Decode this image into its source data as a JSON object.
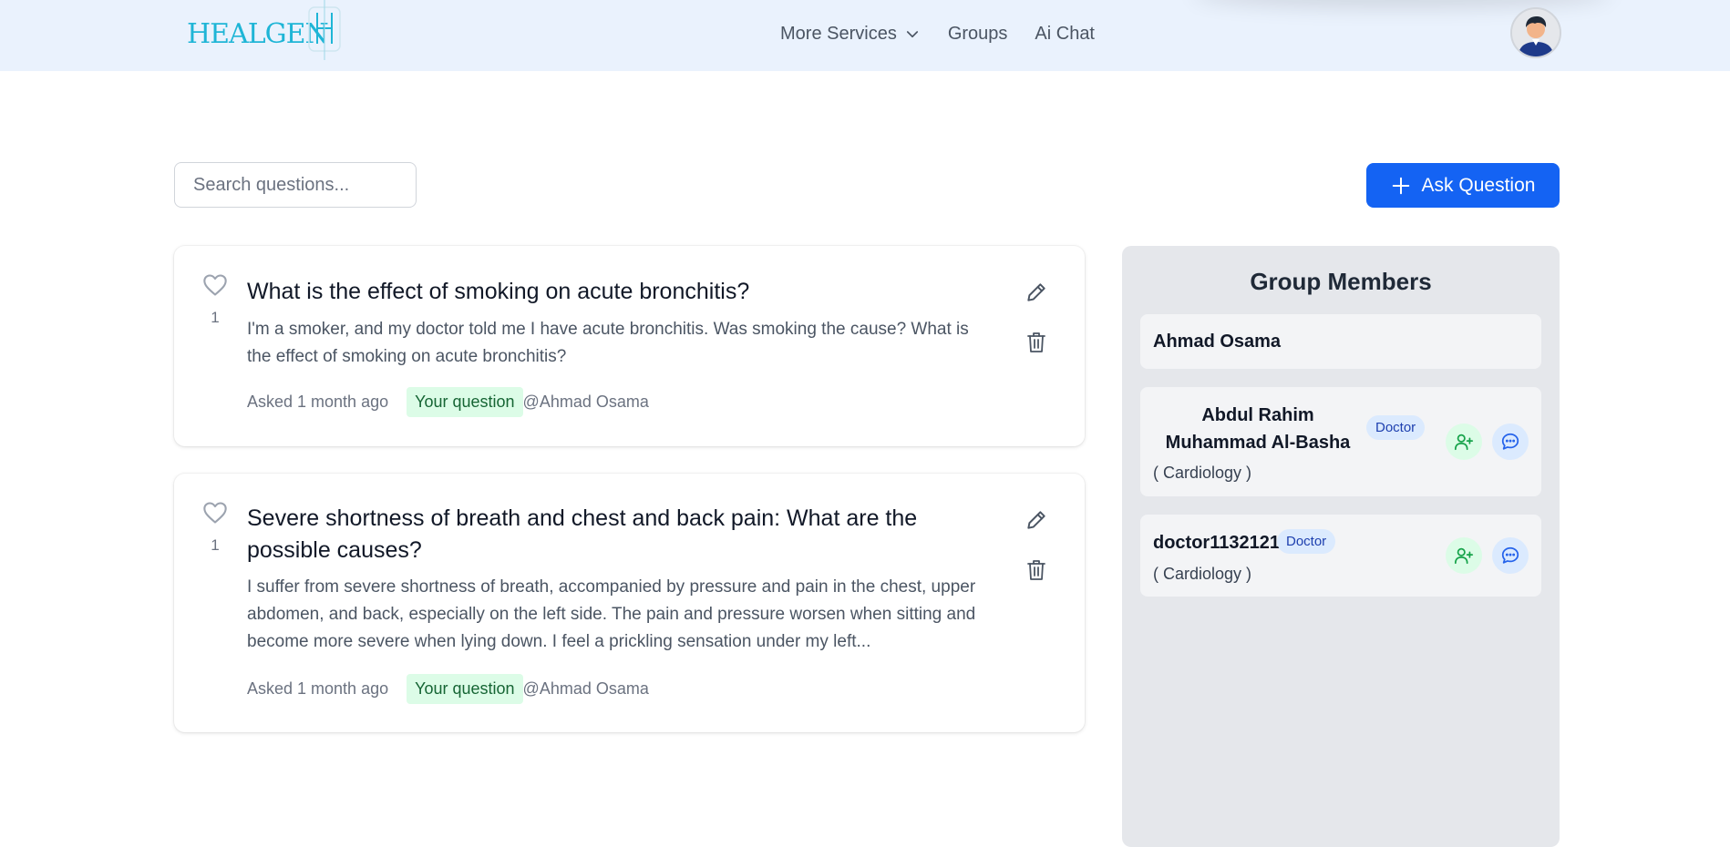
{
  "header": {
    "logo_text": "HEALGEN",
    "nav": {
      "more_services": "More Services",
      "groups": "Groups",
      "ai_chat": "Ai Chat"
    }
  },
  "toolbar": {
    "search_placeholder": "Search questions...",
    "ask_label": "Ask Question"
  },
  "questions": [
    {
      "likes": "1",
      "title": "What is the effect of smoking on acute bronchitis?",
      "body": "I'm a smoker, and my doctor told me I have acute bronchitis. Was smoking the cause? What is the effect of smoking on acute bronchitis?",
      "asked": "Asked 1 month ago",
      "badge": "Your question",
      "author": "@Ahmad Osama"
    },
    {
      "likes": "1",
      "title": "Severe shortness of breath and chest and back pain: What are the possible causes?",
      "body": "I suffer from severe shortness of breath, accompanied by pressure and pain in the chest, upper abdomen, and back, especially on the left side. The pain and pressure worsen when sitting and become more severe when lying down. I feel a prickling sensation under my left...",
      "asked": "Asked 1 month ago",
      "badge": "Your question",
      "author": "@Ahmad Osama"
    }
  ],
  "members_panel": {
    "title": "Group Members",
    "members": [
      {
        "name": "Ahmad Osama"
      },
      {
        "name": "Abdul Rahim Muhammad Al-Basha",
        "role": "Doctor",
        "specialty": "( Cardiology )"
      },
      {
        "name": "doctor1132121",
        "role": "Doctor",
        "specialty": "( Cardiology )"
      }
    ]
  },
  "colors": {
    "navbar_bg": "#eaf2fd",
    "primary": "#1463f3",
    "logo": "#1fb5d6",
    "your_badge_bg": "#dcfce7",
    "doctor_badge_bg": "#dbeafe",
    "panel_bg": "#e5e7eb"
  }
}
